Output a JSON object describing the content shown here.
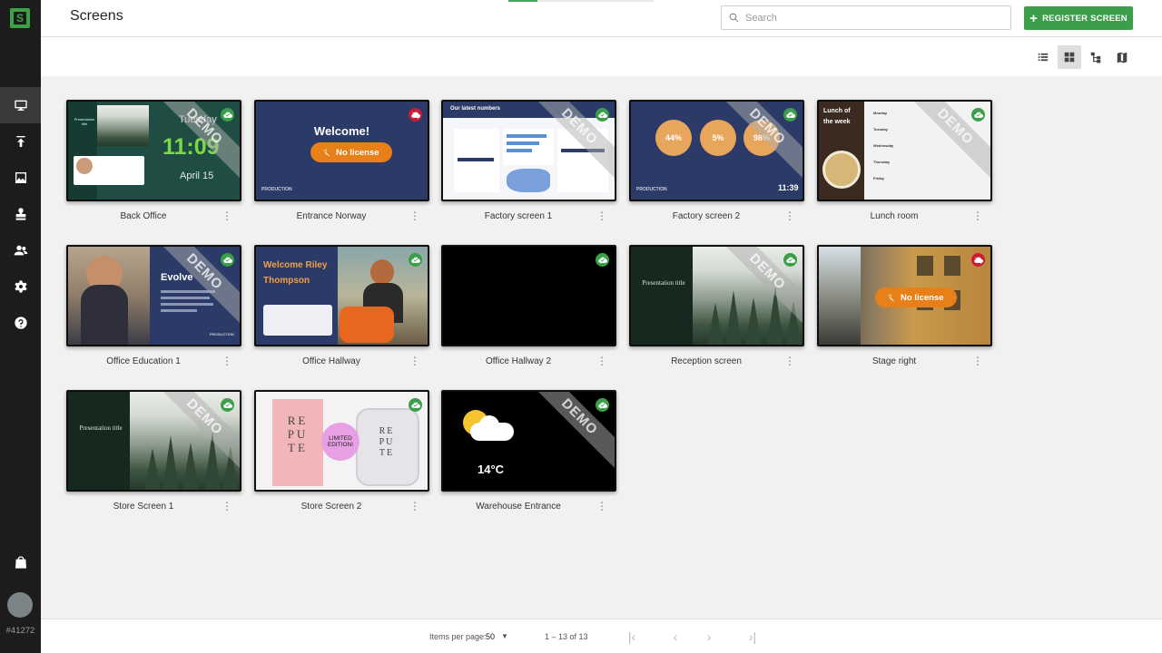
{
  "app": {
    "logo_letter": "S",
    "account_id": "#41272"
  },
  "sidebar": {
    "items": [
      {
        "name": "screens",
        "icon": "monitor-icon"
      },
      {
        "name": "publish",
        "icon": "upload-icon"
      },
      {
        "name": "media",
        "icon": "image-icon"
      },
      {
        "name": "stamp",
        "icon": "stamp-icon"
      },
      {
        "name": "users",
        "icon": "people-icon"
      },
      {
        "name": "settings",
        "icon": "gear-icon"
      },
      {
        "name": "help",
        "icon": "help-icon"
      }
    ],
    "bottom_icon": "bag-icon"
  },
  "header": {
    "title": "Screens",
    "search_placeholder": "Search",
    "register_label": "REGISTER SCREEN"
  },
  "toolbar": {
    "views": [
      "list-view-icon",
      "grid-view-icon",
      "tree-view-icon",
      "map-view-icon"
    ],
    "active_view": "grid-view-icon"
  },
  "screens": [
    {
      "name": "Back Office",
      "status": "online",
      "demo": true,
      "thumb": {
        "time": "11:09",
        "day": "Tuesday",
        "date": "April 15",
        "left_title": "Presentation title"
      }
    },
    {
      "name": "Entrance Norway",
      "status": "offline",
      "demo": false,
      "thumb": {
        "heading": "Welcome!",
        "badge": "No license",
        "footer": "PRODUCTION"
      }
    },
    {
      "name": "Factory screen 1",
      "status": "online",
      "demo": true,
      "thumb": {
        "heading": "Our latest numbers"
      }
    },
    {
      "name": "Factory screen 2",
      "status": "online",
      "demo": true,
      "thumb": {
        "stats": [
          "44%",
          "5%",
          "98%"
        ],
        "time": "11:39",
        "footer": "PRODUCTION"
      }
    },
    {
      "name": "Lunch room",
      "status": "online",
      "demo": true,
      "thumb": {
        "heading": "Lunch of the week",
        "days": [
          "Monday",
          "Tuesday",
          "Wednesday",
          "Thursday",
          "Friday"
        ]
      }
    },
    {
      "name": "Office Education 1",
      "status": "online",
      "demo": true,
      "thumb": {
        "heading": "Evolve",
        "footer": "PRODUCTION"
      }
    },
    {
      "name": "Office Hallway",
      "status": "online",
      "demo": false,
      "thumb": {
        "heading": "Welcome Riley Thompson"
      }
    },
    {
      "name": "Office Hallway 2",
      "status": "online",
      "demo": false,
      "thumb": {}
    },
    {
      "name": "Reception screen",
      "status": "online",
      "demo": true,
      "thumb": {
        "left_title": "Presentation title"
      }
    },
    {
      "name": "Stage right",
      "status": "offline",
      "demo": false,
      "thumb": {
        "badge": "No license"
      }
    },
    {
      "name": "Store Screen 1",
      "status": "online",
      "demo": true,
      "thumb": {
        "left_title": "Presentation title"
      }
    },
    {
      "name": "Store Screen 2",
      "status": "online",
      "demo": false,
      "thumb": {
        "box_text": "RE PU TE",
        "bubble": "LIMITED EDITION!"
      }
    },
    {
      "name": "Warehouse Entrance",
      "status": "online",
      "demo": true,
      "thumb": {
        "temp": "14°C"
      }
    }
  ],
  "footer": {
    "items_per_page_label": "Items per page:",
    "items_per_page_value": "50",
    "range": "1 – 13 of 13"
  },
  "colors": {
    "accent": "#3a9f48",
    "offline": "#c81d34",
    "sidebar": "#1c1c1c"
  }
}
